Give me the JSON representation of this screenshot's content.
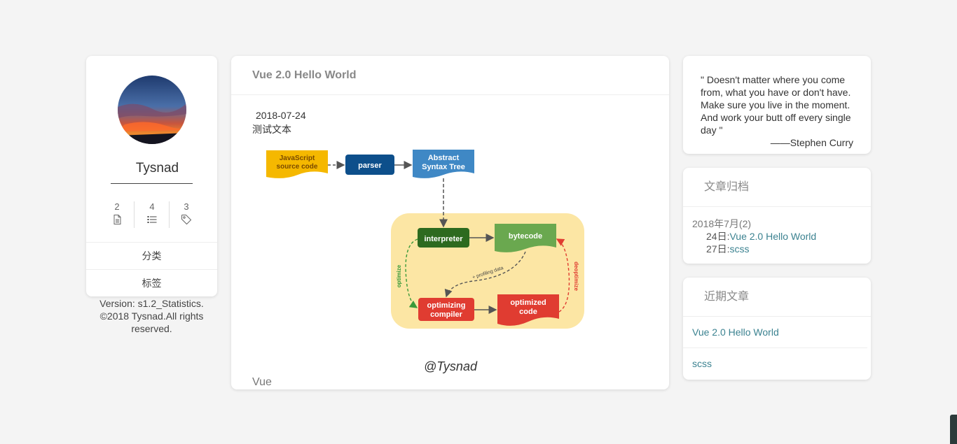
{
  "profile": {
    "name": "Tysnad",
    "stats": [
      {
        "count": "2",
        "icon": "file-icon"
      },
      {
        "count": "4",
        "icon": "list-icon"
      },
      {
        "count": "3",
        "icon": "tag-icon"
      }
    ],
    "menu": [
      "分类",
      "标签"
    ],
    "footer": [
      "Version: s1.2_Statistics.",
      "©2018 Tysnad.All rights",
      "reserved."
    ]
  },
  "article": {
    "title": "Vue 2.0 Hello World",
    "date": "2018-07-24",
    "text": "测试文本",
    "signature": "@Tysnad",
    "tag": "Vue",
    "diagram": {
      "js_source": [
        "JavaScript",
        "source code"
      ],
      "parser": "parser",
      "ast": [
        "Abstract",
        "Syntax Tree"
      ],
      "interpreter": "interpreter",
      "bytecode": "bytecode",
      "optimizing": [
        "optimizing",
        "compiler"
      ],
      "optimized": [
        "optimized",
        "code"
      ],
      "profiling": "+ profiling data",
      "optimize": "optimize",
      "deoptimize": "deoptimize"
    }
  },
  "quote": {
    "text": "\" Doesn't matter where you come from, what you have or don't have. Make sure you live in the moment. And work your butt off every single day \"",
    "author": "——Stephen Curry"
  },
  "archive": {
    "title": "文章归档",
    "month": "2018年7月(2)",
    "items": [
      {
        "day": "24日:",
        "title": "Vue 2.0 Hello World"
      },
      {
        "day": "27日:",
        "title": "scss"
      }
    ]
  },
  "recent": {
    "title": "近期文章",
    "posts": [
      "Vue 2.0 Hello World",
      "scss"
    ]
  },
  "colors": {
    "link": "#3b8290",
    "background": "#f4f4f4",
    "js_box": "#f5b800",
    "parser_box": "#0d4f8b",
    "ast_box": "#3f88c5",
    "interpreter_box": "#2d6a1f",
    "bytecode_box": "#6aa84f",
    "compiler_box": "#e03c31",
    "pipeline_bg": "#fce6a4"
  }
}
